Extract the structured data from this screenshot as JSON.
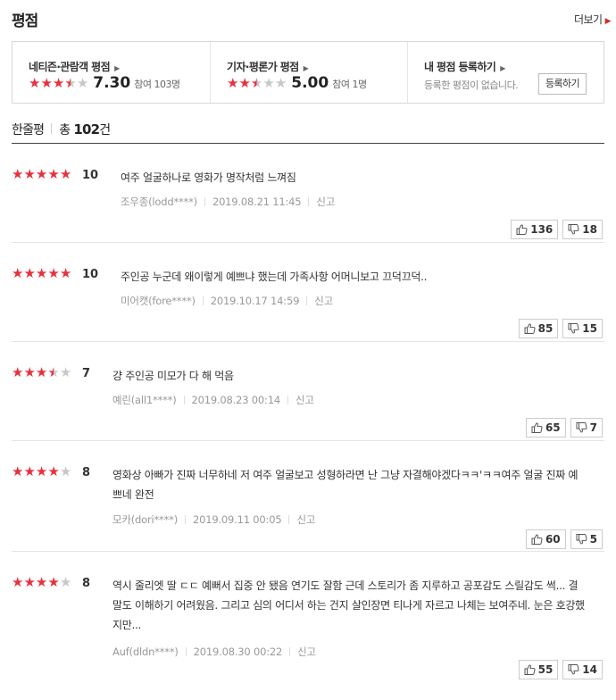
{
  "header": {
    "title": "평점",
    "more_label": "더보기"
  },
  "summary": {
    "netizen": {
      "label": "네티즌·관람객 평점",
      "score": "7.30",
      "participants": "참여 103명",
      "stars": 3.5
    },
    "critic": {
      "label": "기자·평론가 평점",
      "score": "5.00",
      "participants": "참여 1명",
      "stars": 2.5
    },
    "mine": {
      "label": "내 평점 등록하기",
      "empty_text": "등록한 평점이 없습니다.",
      "button_label": "등록하기"
    }
  },
  "list": {
    "tab_label": "한줄평",
    "total_prefix": "총",
    "total_count": "102",
    "total_suffix": "건"
  },
  "reviews": [
    {
      "stars": 5,
      "score": "10",
      "text": "여주 얼굴하나로 영화가 명작처럼 느껴짐",
      "author": "조우종(lodd****)",
      "date": "2019.08.21 11:45",
      "report": "신고",
      "likes": "136",
      "dislikes": "18"
    },
    {
      "stars": 5,
      "score": "10",
      "text": "주인공 누군데 왜이렇게 예쁘냐 했는데 가족사항 어머니보고 끄덕끄덕..",
      "author": "미어캣(fore****)",
      "date": "2019.10.17 14:59",
      "report": "신고",
      "likes": "85",
      "dislikes": "15"
    },
    {
      "stars": 3.5,
      "score": "7",
      "text": "걍 주인공 미모가 다 해 먹음",
      "author": "예린(all1****)",
      "date": "2019.08.23 00:14",
      "report": "신고",
      "likes": "65",
      "dislikes": "7"
    },
    {
      "stars": 4,
      "score": "8",
      "text": "영화상 아빠가 진짜 너무하네 저 여주 얼굴보고 성형하라면 난 그냥 자결해야겠다ㅋㅋ'ㅋㅋ여주 얼굴 진짜 예쁘네 완전",
      "author": "모카(dori****)",
      "date": "2019.09.11 00:05",
      "report": "신고",
      "likes": "60",
      "dislikes": "5"
    },
    {
      "stars": 4,
      "score": "8",
      "text": "역시 줄리엣 딸 ㄷㄷ 예뻐서 집중 안 됐음 연기도 잘함 근데 스토리가 좀 지루하고 공포감도 스릴감도 썩... 결말도 이해하기 어려웠음. 그리고 심의 어디서 하는 건지 살인장면 티나게 자르고 나체는 보여주네. 눈은 호강했지만...",
      "author": "Auf(dldn****)",
      "date": "2019.08.30 00:22",
      "report": "신고",
      "likes": "55",
      "dislikes": "14"
    }
  ],
  "colors": {
    "star_on": "#e8303d",
    "star_off": "#c8c8c8",
    "accent": "#d02a2a"
  },
  "icons": {
    "like": "thumbs-up-icon",
    "dislike": "thumbs-down-icon",
    "more": "chevron-right-icon"
  }
}
